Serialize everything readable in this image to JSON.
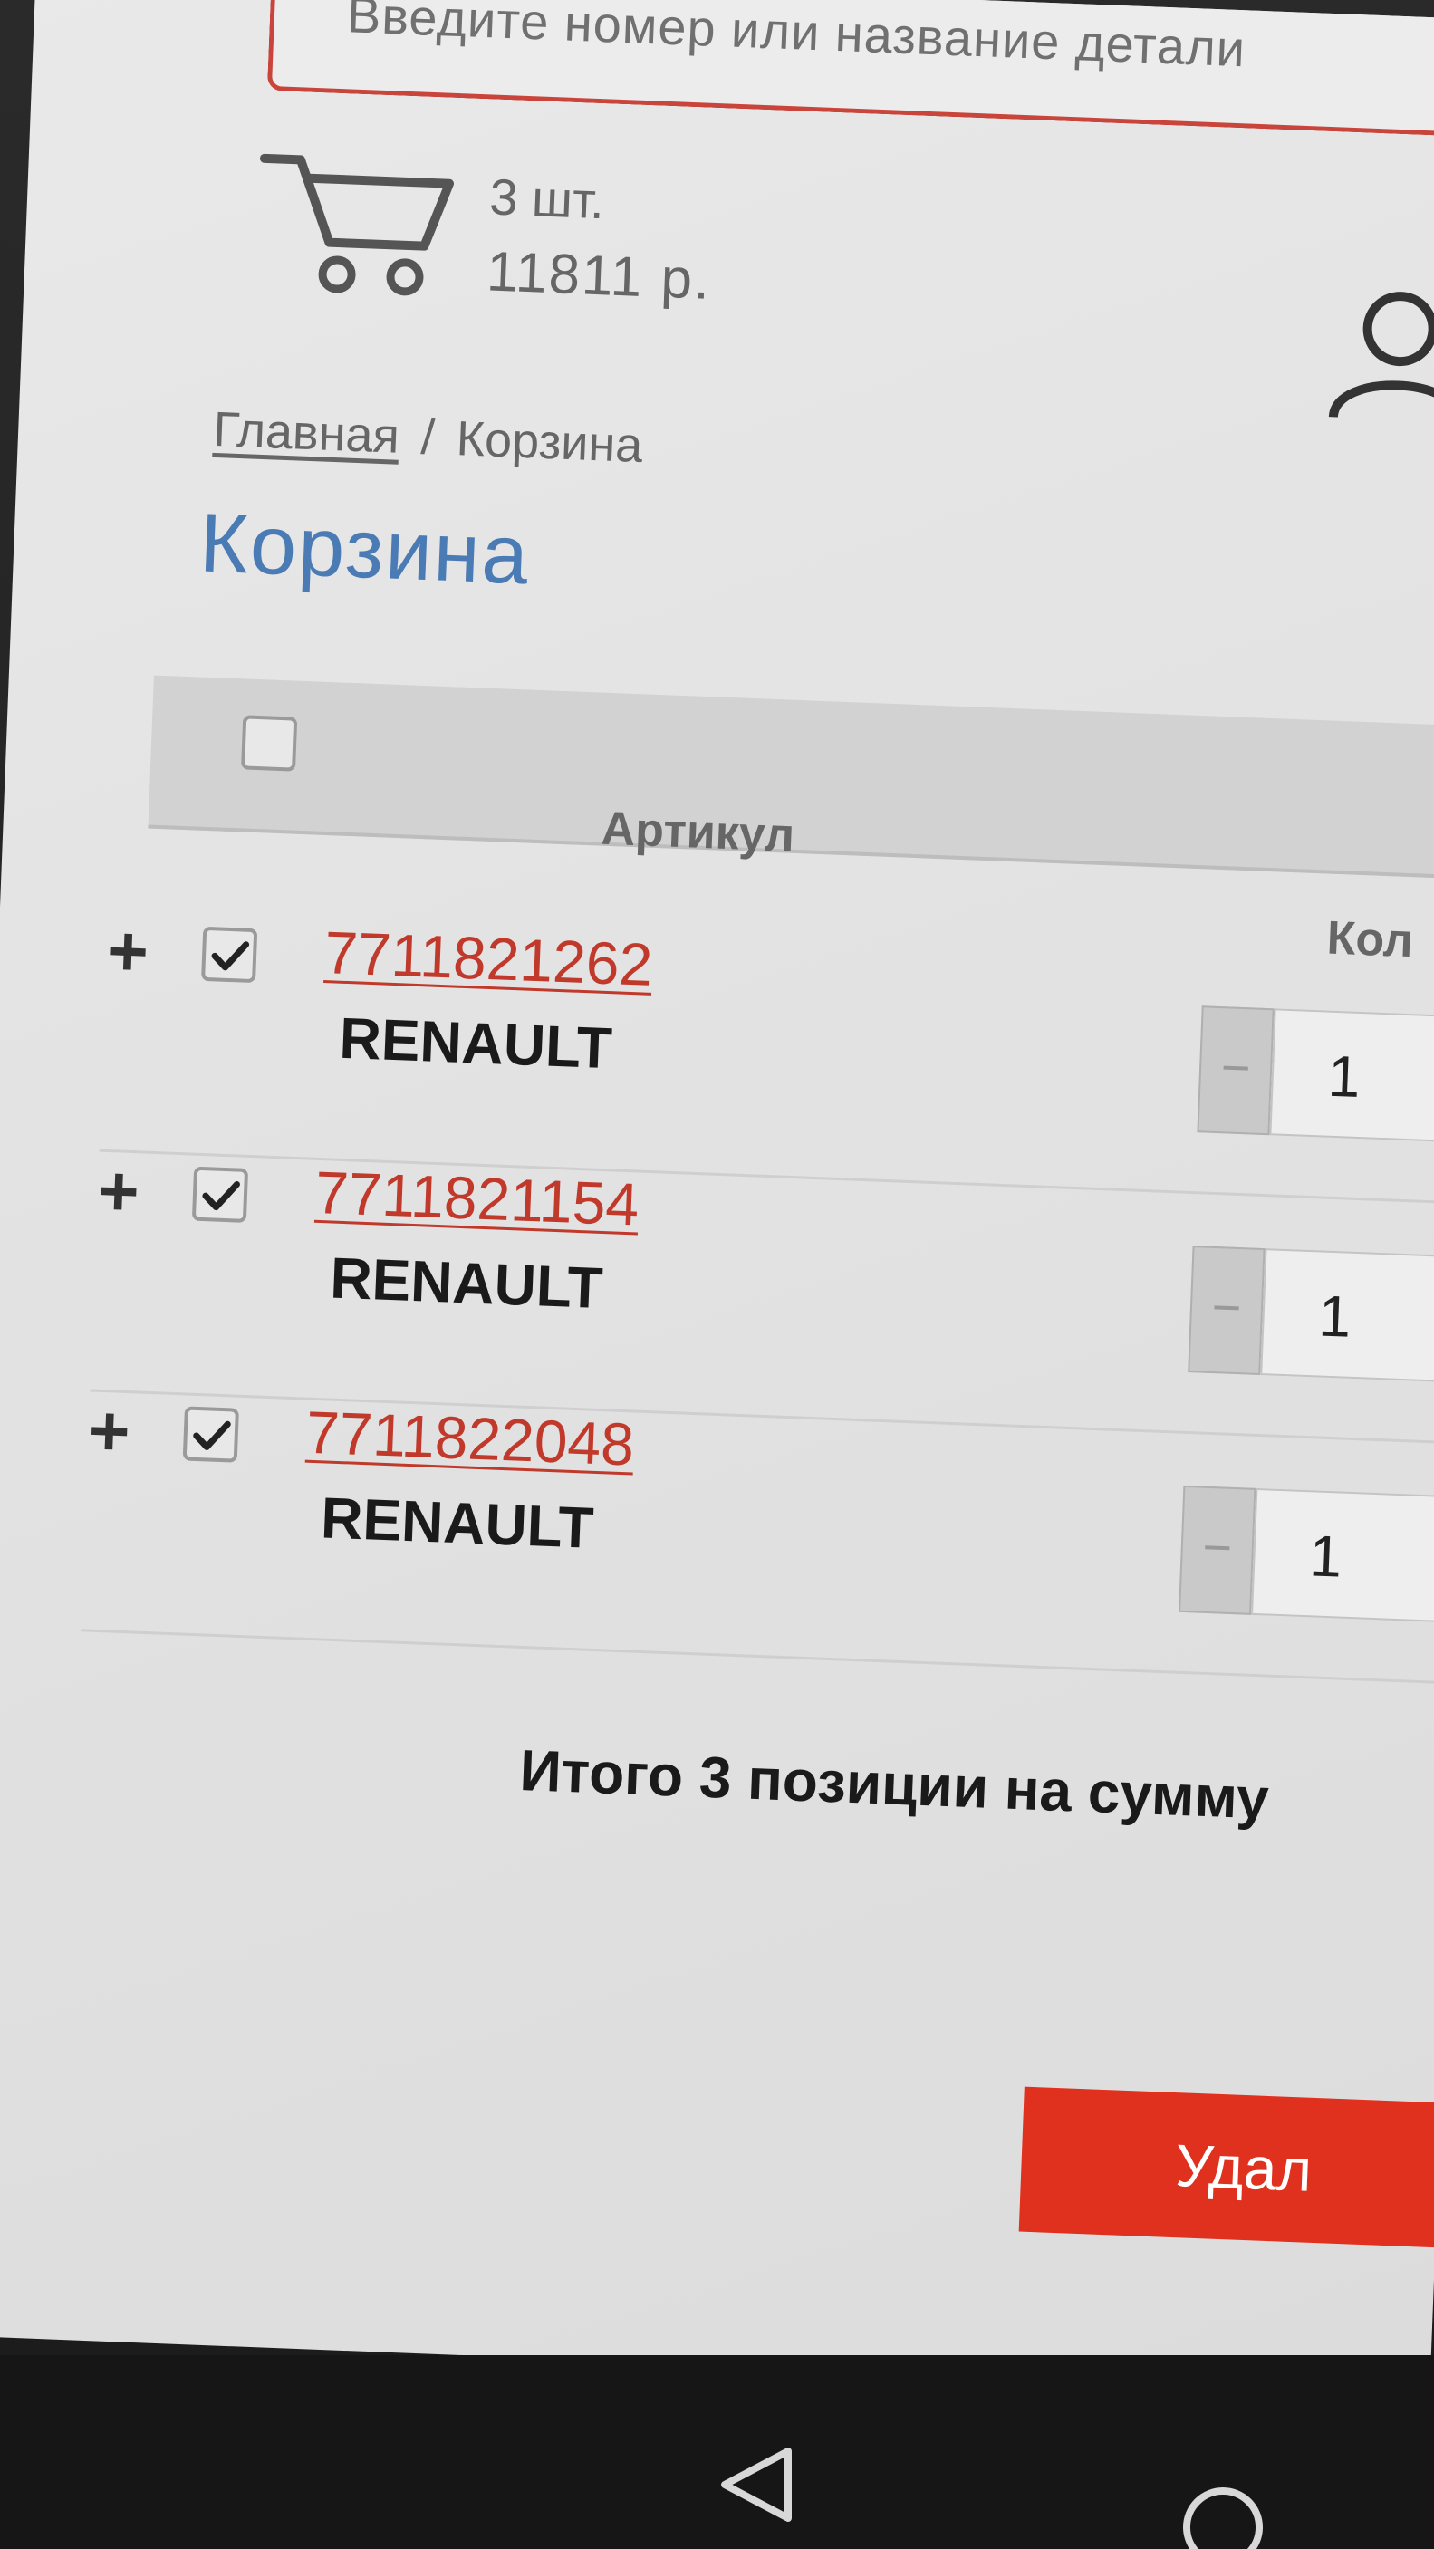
{
  "search": {
    "placeholder": "Введите номер или название детали"
  },
  "cart": {
    "count": "3 шт.",
    "sum": "11811 р."
  },
  "breadcrumb": {
    "home": "Главная",
    "separator": "/",
    "current": "Корзина"
  },
  "page_title": "Корзина",
  "table": {
    "headers": {
      "article": "Артикул",
      "quantity": "Кол"
    },
    "rows": [
      {
        "article": "7711821262",
        "brand": "RENAULT",
        "qty": "1",
        "checked": true
      },
      {
        "article": "7711821154",
        "brand": "RENAULT",
        "qty": "1",
        "checked": true
      },
      {
        "article": "7711822048",
        "brand": "RENAULT",
        "qty": "1",
        "checked": true
      }
    ],
    "expand_symbol": "+",
    "minus_symbol": "−"
  },
  "summary": {
    "total_text": "Итого 3 позиции на сумму"
  },
  "actions": {
    "delete_label": "Удал"
  },
  "colors": {
    "accent_red": "#e0301e",
    "link_red": "#c0392b",
    "title_blue": "#4a7bb5"
  }
}
